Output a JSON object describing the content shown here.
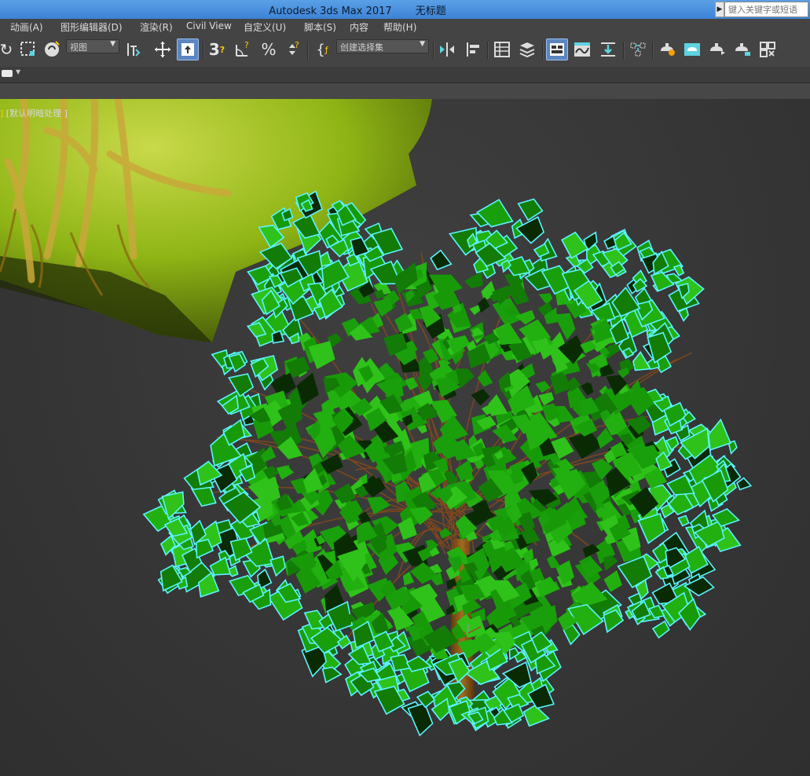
{
  "window": {
    "app_title": "Autodesk 3ds Max 2017",
    "doc_title": "无标题",
    "search_placeholder": "键入关键字或短语"
  },
  "menu": [
    {
      "label": "动画(A)"
    },
    {
      "label": "图形编辑器(D)"
    },
    {
      "label": "渲染(R)"
    },
    {
      "label": "Civil View"
    },
    {
      "label": "自定义(U)"
    },
    {
      "label": "脚本(S)"
    },
    {
      "label": "内容"
    },
    {
      "label": "帮助(H)"
    }
  ],
  "toolbar": {
    "view_dropdown": "视图",
    "selection_set_dropdown": "创建选择集",
    "icons": [
      "redo-icon",
      "select-region-icon",
      "select-by-name-icon",
      "select-and-link-icon",
      "move-icon",
      "select-place-icon",
      "snap-3d-icon",
      "angle-snap-icon",
      "percent-snap-icon",
      "spinner-snap-icon",
      "edit-named-selection-icon",
      "mirror-icon",
      "align-icon",
      "scene-explorer-icon",
      "layer-explorer-icon",
      "ribbon-toggle-icon",
      "curve-editor-icon",
      "schematic-view-icon",
      "material-editor-icon",
      "render-setup-icon",
      "rendered-frame-window-icon",
      "render-production-icon",
      "render-iterative-icon",
      "render-in-cloud-icon",
      "active-shade-icon"
    ]
  },
  "viewport": {
    "shading_label": "[默认明暗处理 ]",
    "selection_color": "#5cf2ff",
    "leaf_color": "#1a9f0c",
    "trunk_color": "#8a5a18",
    "background_object_color": "#9ac217"
  }
}
